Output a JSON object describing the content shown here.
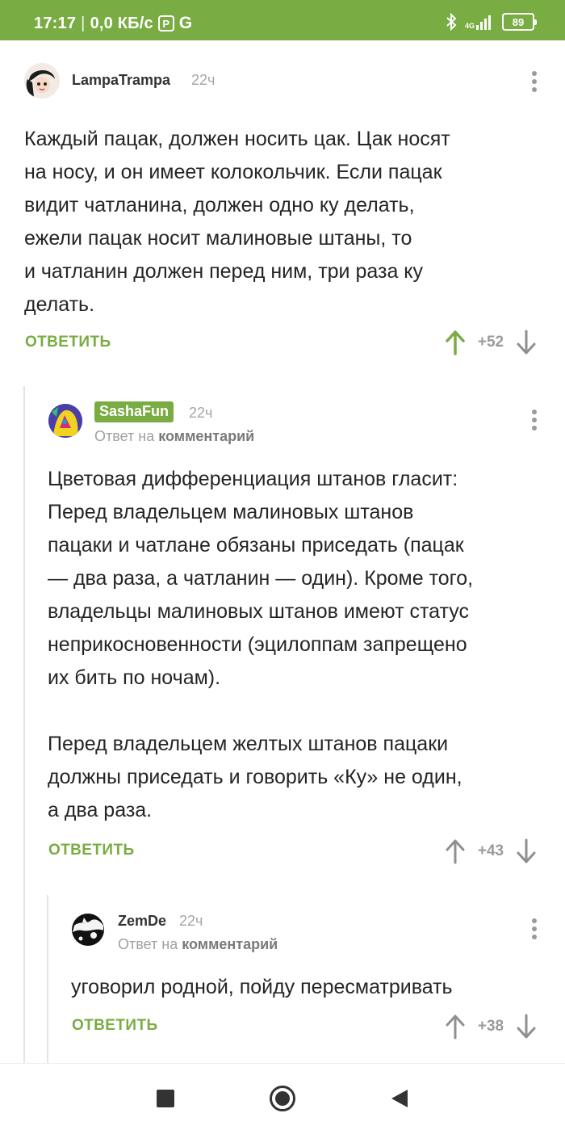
{
  "status": {
    "time": "17:17",
    "speed": "0,0 КБ/с",
    "p_icon": "P",
    "g_icon": "G",
    "network": "4G",
    "battery": "89",
    "bar_color": "#79ac43"
  },
  "comments": {
    "c1": {
      "user": "LampaTrampa",
      "time": "22ч",
      "lines": [
        "Каждый пацак, должен носить цак. Цак носят",
        "на носу, и он имеет колокольчик. Если пацак",
        "видит чатланина, должен одно ку делать,",
        "ежели пацак носит малиновые штаны, то",
        "и чатланин должен перед ним, три раза ку",
        "делать."
      ],
      "reply_label": "ОТВЕТИТЬ",
      "score": "+52"
    },
    "c2": {
      "user": "SashaFun",
      "time": "22ч",
      "reply_to_prefix": "Ответ на",
      "reply_to_target": "комментарий",
      "para1": [
        "Цветовая дифференциация штанов гласит:",
        "Перед владельцем малиновых штанов",
        "пацаки и чатлане обязаны приседать (пацак",
        "— два раза, а чатланин — один). Кроме того,",
        "владельцы малиновых штанов имеют статус",
        "неприкосновенности (эцилоппам запрещено",
        "их бить по ночам)."
      ],
      "para2": [
        "Перед владельцем желтых штанов пацаки",
        "должны приседать и говорить «Ку» не один,",
        "а два раза."
      ],
      "reply_label": "ОТВЕТИТЬ",
      "score": "+43"
    },
    "c3": {
      "user": "ZemDe",
      "time": "22ч",
      "reply_to_prefix": "Ответ на",
      "reply_to_target": "комментарий",
      "text": "уговорил родной, пойду пересматривать",
      "reply_label": "ОТВЕТИТЬ",
      "score": "+38"
    }
  },
  "colors": {
    "accent": "#79ac43",
    "upvote_active": "#79ac43",
    "icon_gray": "#9b9b9b"
  },
  "icons": {
    "up": "arrow-up-icon",
    "down": "arrow-down-icon",
    "menu": "more-vertical-icon",
    "nav_recent": "square-icon",
    "nav_home": "circle-icon",
    "nav_back": "triangle-back-icon"
  }
}
